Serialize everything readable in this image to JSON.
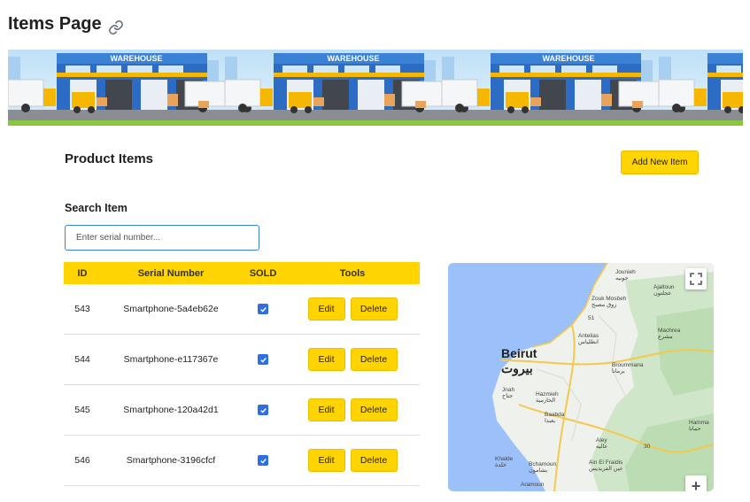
{
  "page": {
    "title": "Items Page"
  },
  "banner": {
    "sign_text": "WAREHOUSE"
  },
  "products": {
    "title": "Product Items",
    "add_button": "Add New Item",
    "search_label": "Search Item",
    "search_placeholder": "Enter serial number..."
  },
  "table": {
    "headers": {
      "id": "ID",
      "serial": "Serial Number",
      "sold": "SOLD",
      "tools": "Tools"
    },
    "rows": [
      {
        "id": "543",
        "serial": "Smartphone-5a4eb62e",
        "sold": true
      },
      {
        "id": "544",
        "serial": "Smartphone-e117367e",
        "sold": true
      },
      {
        "id": "545",
        "serial": "Smartphone-120a42d1",
        "sold": true
      },
      {
        "id": "546",
        "serial": "Smartphone-3196cfcf",
        "sold": true
      }
    ],
    "edit_label": "Edit",
    "delete_label": "Delete"
  },
  "map": {
    "city_name": "Beirut",
    "city_name_ar": "بيروت",
    "places": [
      {
        "name": "Jounieh",
        "ar": "جونيه"
      },
      {
        "name": "Ajaltoun",
        "ar": "عجلتون"
      },
      {
        "name": "Zouk Mosbeh",
        "ar": "زوق مصبح"
      },
      {
        "name": "51",
        "ar": ""
      },
      {
        "name": "Antelias",
        "ar": "انطلياس"
      },
      {
        "name": "Machrea",
        "ar": "مشرع"
      },
      {
        "name": "Broummana",
        "ar": "برمانا"
      },
      {
        "name": "Jnah",
        "ar": "جناح"
      },
      {
        "name": "Hazmieh",
        "ar": "الحازمية"
      },
      {
        "name": "Baabda",
        "ar": "بعبدا"
      },
      {
        "name": "Aley",
        "ar": "عاليه"
      },
      {
        "name": "Khalde",
        "ar": "خلدة"
      },
      {
        "name": "Bchamoun",
        "ar": "بشامون"
      },
      {
        "name": "Ain El Fraidis",
        "ar": "عين الفريديس"
      },
      {
        "name": "30",
        "ar": ""
      },
      {
        "name": "Hamma",
        "ar": "حمانا"
      },
      {
        "name": "Aramoun",
        "ar": ""
      }
    ],
    "zoom_in": "+"
  },
  "colors": {
    "accent": "#ffd400",
    "checkbox": "#2f6fe0",
    "input_focus": "#3b82e0",
    "sea": "#9cc0f9",
    "land": "#eef1ec",
    "hills": "#cfe6c8"
  },
  "icons": {
    "title": "link-icon",
    "fullscreen": "fullscreen-icon",
    "checkbox": "checkmark-icon"
  }
}
